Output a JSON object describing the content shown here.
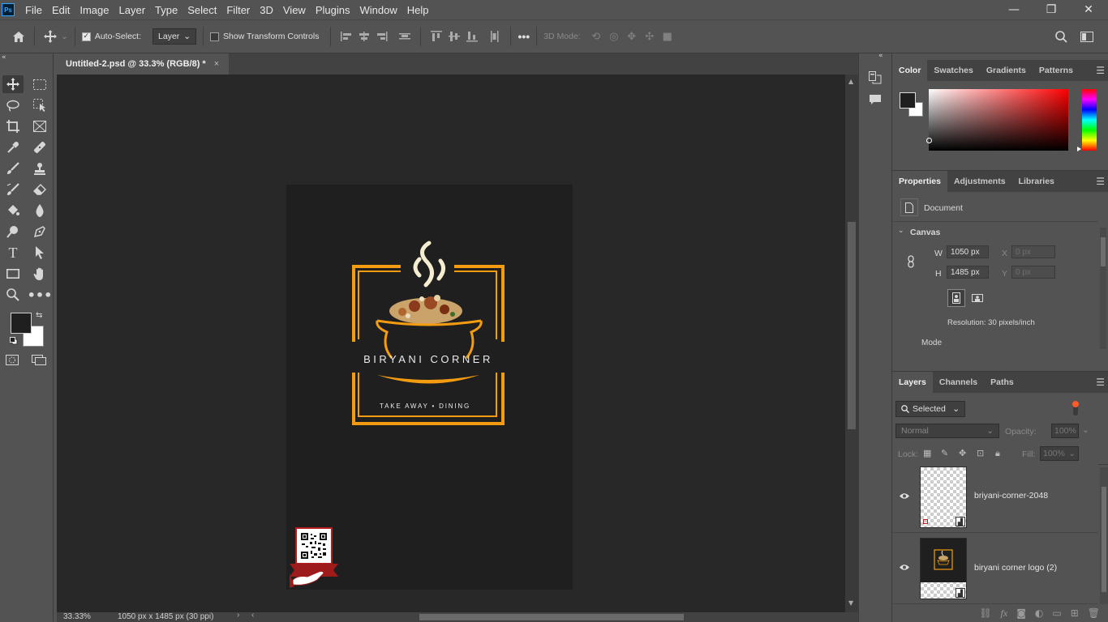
{
  "app": {
    "logo": "Ps"
  },
  "menu": [
    "File",
    "Edit",
    "Image",
    "Layer",
    "Type",
    "Select",
    "Filter",
    "3D",
    "View",
    "Plugins",
    "Window",
    "Help"
  ],
  "window_controls": {
    "minimize": "—",
    "restore": "❐",
    "close": "✕"
  },
  "options": {
    "auto_select_label": "Auto-Select:",
    "auto_select_target": "Layer",
    "show_transform_label": "Show Transform Controls",
    "more": "•••",
    "mode_3d_label": "3D Mode:"
  },
  "document": {
    "tab_title": "Untitled-2.psd @ 33.3% (RGB/8) *",
    "close": "×"
  },
  "artwork": {
    "brand": "BIRYANI CORNER",
    "tagline": "TAKE AWAY • DINING"
  },
  "status": {
    "zoom": "33.33%",
    "doc_info": "1050 px x 1485 px (30 ppi)"
  },
  "color_panel": {
    "tabs": [
      "Color",
      "Swatches",
      "Gradients",
      "Patterns"
    ],
    "active": "Color"
  },
  "properties_panel": {
    "tabs": [
      "Properties",
      "Adjustments",
      "Libraries"
    ],
    "active": "Properties",
    "doc_label": "Document",
    "section": "Canvas",
    "w_label": "W",
    "w_value": "1050 px",
    "h_label": "H",
    "h_value": "1485 px",
    "x_label": "X",
    "x_placeholder": "0 px",
    "y_label": "Y",
    "y_placeholder": "0 px",
    "resolution": "Resolution: 30 pixels/inch",
    "mode_label": "Mode"
  },
  "layers_panel": {
    "tabs": [
      "Layers",
      "Channels",
      "Paths"
    ],
    "active": "Layers",
    "filter": "Selected",
    "blend_mode": "Normal",
    "opacity_label": "Opacity:",
    "opacity_value": "100%",
    "lock_label": "Lock:",
    "fill_label": "Fill:",
    "fill_value": "100%",
    "layers": [
      {
        "name": "briyani-corner-2048"
      },
      {
        "name": "biryani corner logo (2)"
      }
    ]
  },
  "colors": {
    "accent_orange": "#f39c12",
    "foreground": "#1f1f1f",
    "background": "#ffffff"
  }
}
